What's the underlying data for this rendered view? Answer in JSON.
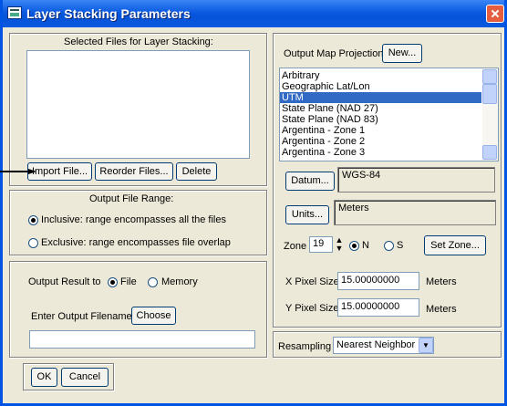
{
  "window": {
    "title": "Layer Stacking Parameters"
  },
  "selected_files": {
    "label": "Selected Files for Layer Stacking:",
    "items": []
  },
  "file_buttons": {
    "import": "Import File...",
    "reorder": "Reorder Files...",
    "delete": "Delete"
  },
  "output_range": {
    "title": "Output File Range:",
    "inclusive_label": "Inclusive: range encompasses all the files",
    "exclusive_label": "Exclusive: range encompasses file overlap",
    "selected": "inclusive"
  },
  "output_result": {
    "label": "Output Result to",
    "file_label": "File",
    "memory_label": "Memory",
    "selected": "file",
    "filename_label": "Enter Output Filename",
    "choose_label": "Choose",
    "filename_value": ""
  },
  "dialog_buttons": {
    "ok": "OK",
    "cancel": "Cancel"
  },
  "projection": {
    "label": "Output Map Projection",
    "new_button": "New...",
    "items": [
      "Arbitrary",
      "Geographic Lat/Lon",
      "UTM",
      "State Plane (NAD 27)",
      "State Plane (NAD 83)",
      "Argentina - Zone 1",
      "Argentina - Zone 2",
      "Argentina - Zone 3"
    ],
    "selected": "UTM"
  },
  "datum": {
    "button": "Datum...",
    "value": "WGS-84"
  },
  "units": {
    "button": "Units...",
    "value": "Meters"
  },
  "zone": {
    "label": "Zone",
    "value": "19",
    "n_label": "N",
    "s_label": "S",
    "hemisphere": "N",
    "set_button": "Set Zone..."
  },
  "pixel_size": {
    "x_label": "X Pixel Size",
    "x_value": "15.00000000",
    "x_unit": "Meters",
    "y_label": "Y Pixel Size",
    "y_value": "15.00000000",
    "y_unit": "Meters"
  },
  "resampling": {
    "label": "Resampling",
    "value": "Nearest Neighbor"
  },
  "icons": {
    "title": "app-window-icon",
    "close": "close-icon",
    "arrow": "callout-arrow-icon"
  }
}
